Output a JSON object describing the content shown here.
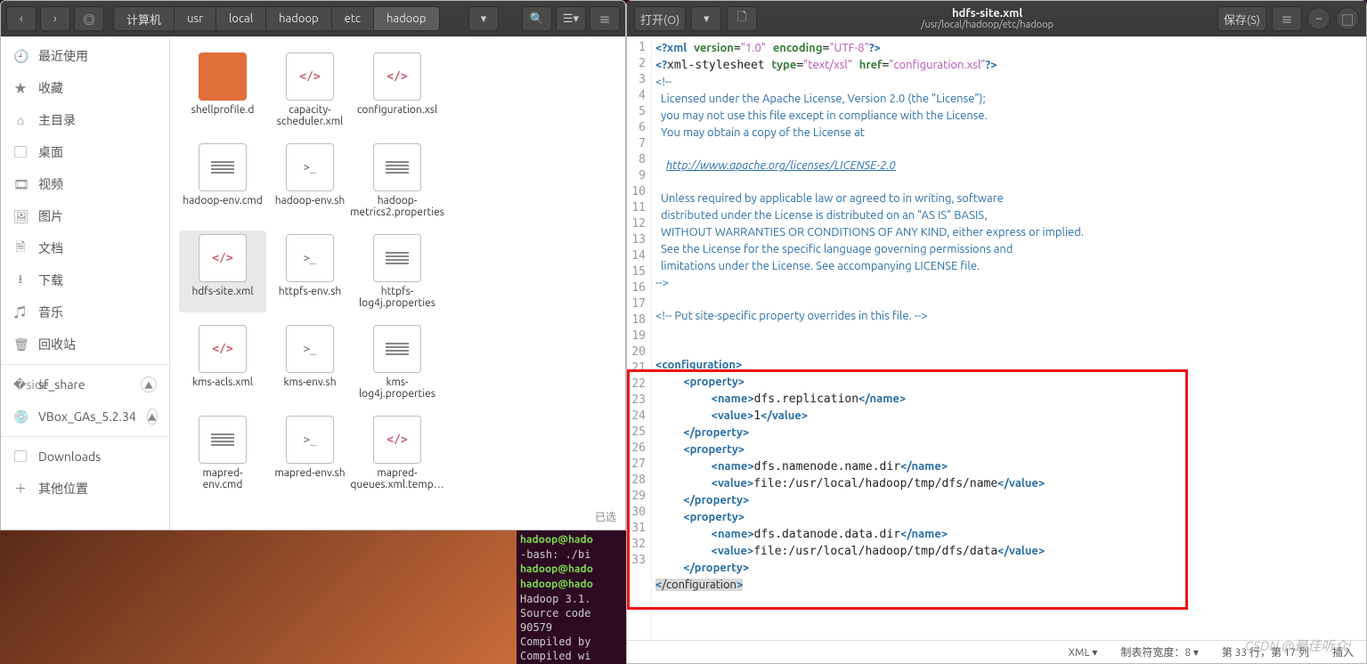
{
  "fm": {
    "breadcrumbs": [
      "计算机",
      "usr",
      "local",
      "hadoop",
      "etc",
      "hadoop"
    ],
    "caret": "▾",
    "sidebar": [
      {
        "ico": "🕘",
        "label": "最近使用"
      },
      {
        "ico": "★",
        "label": "收藏"
      },
      {
        "ico": "⌂",
        "label": "主目录"
      },
      {
        "ico": "▢",
        "label": "桌面"
      },
      {
        "ico": "🎞",
        "label": "视频"
      },
      {
        "ico": "🖼",
        "label": "图片"
      },
      {
        "ico": "🗎",
        "label": "文档"
      },
      {
        "ico": "⭳",
        "label": "下载"
      },
      {
        "ico": "♫",
        "label": "音乐"
      },
      {
        "ico": "🗑",
        "label": "回收站"
      }
    ],
    "mounts": [
      {
        "ico": "�side",
        "label": "sf_share",
        "eject": true
      },
      {
        "ico": "💿",
        "label": "VBox_GAs_5.2.34",
        "eject": true
      }
    ],
    "extra": [
      {
        "ico": "▢",
        "label": "Downloads"
      },
      {
        "ico": "＋",
        "label": "其他位置"
      }
    ],
    "files": [
      {
        "name": "shellprofile.d",
        "t": "folder"
      },
      {
        "name": "capacity-scheduler.xml",
        "t": "xml"
      },
      {
        "name": "configuration.xsl",
        "t": "xml"
      },
      {
        "name": "hadoop-env.cmd",
        "t": "txt"
      },
      {
        "name": "hadoop-env.sh",
        "t": "sh"
      },
      {
        "name": "hadoop-metrics2.properties",
        "t": "txt"
      },
      {
        "name": "hdfs-site.xml",
        "t": "xml",
        "sel": true
      },
      {
        "name": "httpfs-env.sh",
        "t": "sh"
      },
      {
        "name": "httpfs-log4j.properties",
        "t": "txt"
      },
      {
        "name": "kms-acls.xml",
        "t": "xml"
      },
      {
        "name": "kms-env.sh",
        "t": "sh"
      },
      {
        "name": "kms-log4j.properties",
        "t": "txt"
      },
      {
        "name": "mapred-env.cmd",
        "t": "txt"
      },
      {
        "name": "mapred-env.sh",
        "t": "sh"
      },
      {
        "name": "mapred-queues.xml.temp…",
        "t": "xml"
      }
    ],
    "status": "已选"
  },
  "ge": {
    "open": "打开(O)",
    "save": "保存(S)",
    "title": "hdfs-site.xml",
    "subtitle": "/usr/local/hadoop/etc/hadoop",
    "status": {
      "lang": "XML ▾",
      "tab": "制表符宽度：8 ▾",
      "pos": "第 33 行，第 17 列",
      "ins": "插入"
    },
    "lines": [
      {
        "n": 1,
        "h": "<span class='c-tag'>&lt;?xml</span> <span class='c-kw'>version</span>=<span class='c-str'>\"1.0\"</span> <span class='c-kw'>encoding</span>=<span class='c-str'>\"UTF-8\"</span><span class='c-tag'>?&gt;</span>"
      },
      {
        "n": 2,
        "h": "<span class='c-tag'>&lt;?</span>xml-stylesheet <span class='c-kw'>type</span>=<span class='c-str'>\"text/xsl\"</span> <span class='c-kw'>href</span>=<span class='c-str'>\"configuration.xsl\"</span><span class='c-tag'>?&gt;</span>"
      },
      {
        "n": 3,
        "h": "<span class='c-cmt'>&lt;!--</span>"
      },
      {
        "n": 4,
        "h": "<span class='c-cmt'>  Licensed under the Apache License, Version 2.0 (the \"License\");</span>"
      },
      {
        "n": 5,
        "h": "<span class='c-cmt'>  you may not use this file except in compliance with the License.</span>"
      },
      {
        "n": 6,
        "h": "<span class='c-cmt'>  You may obtain a copy of the License at</span>"
      },
      {
        "n": 7,
        "h": ""
      },
      {
        "n": 8,
        "h": "<span class='c-cmt'>    </span><span class='c-url'>http://www.apache.org/licenses/LICENSE-2.0</span>"
      },
      {
        "n": 9,
        "h": ""
      },
      {
        "n": 10,
        "h": "<span class='c-cmt'>  Unless required by applicable law or agreed to in writing, software</span>"
      },
      {
        "n": 11,
        "h": "<span class='c-cmt'>  distributed under the License is distributed on an \"AS IS\" BASIS,</span>"
      },
      {
        "n": 12,
        "h": "<span class='c-cmt'>  WITHOUT WARRANTIES OR CONDITIONS OF ANY KIND, either express or implied.</span>"
      },
      {
        "n": 13,
        "h": "<span class='c-cmt'>  See the License for the specific language governing permissions and</span>"
      },
      {
        "n": 14,
        "h": "<span class='c-cmt'>  limitations under the License. See accompanying LICENSE file.</span>"
      },
      {
        "n": 15,
        "h": "<span class='c-cmt'>--&gt;</span>"
      },
      {
        "n": 16,
        "h": ""
      },
      {
        "n": 17,
        "h": "<span class='c-cmt'>&lt;!-- Put site-specific property overrides in this file. --&gt;</span>"
      },
      {
        "n": 18,
        "h": ""
      },
      {
        "n": 19,
        "h": ""
      },
      {
        "n": 20,
        "h": "<span class='c-tag'>&lt;configuration&gt;</span>"
      },
      {
        "n": 21,
        "h": "    <span class='c-tag'>&lt;property&gt;</span>"
      },
      {
        "n": 22,
        "h": "        <span class='c-tag'>&lt;name&gt;</span>dfs.replication<span class='c-tag'>&lt;/name&gt;</span>"
      },
      {
        "n": 23,
        "h": "        <span class='c-tag'>&lt;value&gt;</span>1<span class='c-tag'>&lt;/value&gt;</span>"
      },
      {
        "n": 24,
        "h": "    <span class='c-tag'>&lt;/property&gt;</span>"
      },
      {
        "n": 25,
        "h": "    <span class='c-tag'>&lt;property&gt;</span>"
      },
      {
        "n": 26,
        "h": "        <span class='c-tag'>&lt;name&gt;</span>dfs.namenode.name.dir<span class='c-tag'>&lt;/name&gt;</span>"
      },
      {
        "n": 27,
        "h": "        <span class='c-tag'>&lt;value&gt;</span>file:/usr/local/hadoop/tmp/dfs/name<span class='c-tag'>&lt;/value&gt;</span>"
      },
      {
        "n": 28,
        "h": "    <span class='c-tag'>&lt;/property&gt;</span>"
      },
      {
        "n": 29,
        "h": "    <span class='c-tag'>&lt;property&gt;</span>"
      },
      {
        "n": 30,
        "h": "        <span class='c-tag'>&lt;name&gt;</span>dfs.datanode.data.dir<span class='c-tag'>&lt;/name&gt;</span>"
      },
      {
        "n": 31,
        "h": "        <span class='c-tag'>&lt;value&gt;</span>file:/usr/local/hadoop/tmp/dfs/data<span class='c-tag'>&lt;/value&gt;</span>"
      },
      {
        "n": 32,
        "h": "    <span class='c-tag'>&lt;/property&gt;</span>"
      },
      {
        "n": 33,
        "h": "<span class='c-cur'><span class='c-tag'>&lt;</span>/configuration<span class='c-tag'>&gt;</span></span>"
      }
    ]
  },
  "term": [
    {
      "g": "hadoop@hado"
    },
    {
      "t": "-bash: ./bi"
    },
    {
      "g": "hadoop@hado"
    },
    {
      "g": "hadoop@hado"
    },
    {
      "t": "Hadoop 3.1."
    },
    {
      "t": "Source code"
    },
    {
      "t": "90579"
    },
    {
      "t": "Compiled by"
    },
    {
      "t": "Compiled wi"
    }
  ],
  "wm": "CSDN @最佳听众!"
}
